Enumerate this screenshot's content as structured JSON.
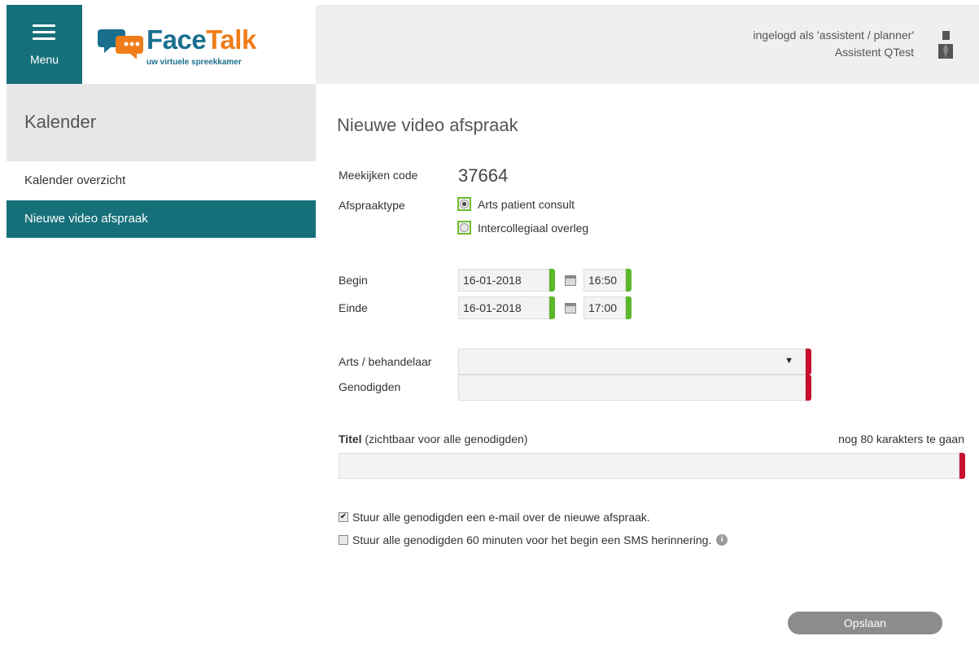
{
  "header": {
    "menu_label": "Menu",
    "logo_face": "Face",
    "logo_talk": "Talk",
    "logo_tagline": "uw virtuele spreekkamer",
    "user_line1": "ingelogd als 'assistent / planner'",
    "user_line2": "Assistent QTest"
  },
  "sidebar": {
    "title": "Kalender",
    "items": [
      {
        "label": "Kalender overzicht"
      },
      {
        "label": "Nieuwe video afspraak"
      }
    ]
  },
  "form": {
    "page_title": "Nieuwe video afspraak",
    "meekijken_label": "Meekijken code",
    "meekijken_value": "37664",
    "afspraaktype_label": "Afspraaktype",
    "radio_options": [
      {
        "label": "Arts patient consult",
        "selected": true
      },
      {
        "label": "Intercollegiaal overleg",
        "selected": false
      }
    ],
    "begin_label": "Begin",
    "begin_date": "16-01-2018",
    "begin_time": "16:50",
    "einde_label": "Einde",
    "einde_date": "16-01-2018",
    "einde_time": "17:00",
    "arts_label": "Arts / behandelaar",
    "arts_value": "",
    "arts_arrow": "▼",
    "genodigden_label": "Genodigden",
    "genodigden_value": "",
    "titel_label_bold": "Titel",
    "titel_label_rest": " (zichtbaar voor alle genodigden)",
    "titel_counter": "nog 80 karakters te gaan",
    "titel_value": "",
    "checkbox_email": {
      "label": "Stuur alle genodigden een e-mail over de nieuwe afspraak.",
      "checked": true
    },
    "checkbox_sms": {
      "label": "Stuur alle genodigden 60 minuten voor het begin een SMS herinnering.",
      "checked": false
    },
    "save_label": "Opslaan"
  },
  "colors": {
    "teal": "#16707a",
    "valid": "#5cb82a",
    "invalid": "#c8102e",
    "logo_blue": "#1a6f8f",
    "logo_orange": "#f07d1a"
  }
}
